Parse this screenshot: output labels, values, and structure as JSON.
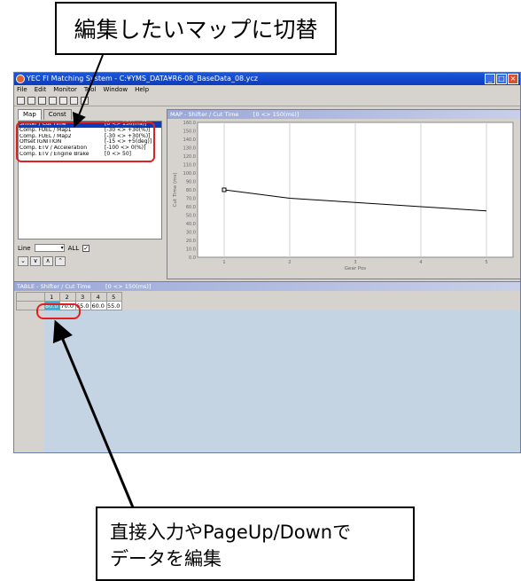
{
  "callouts": {
    "top": "編集したいマップに切替",
    "bottom_line1": "直接入力やPageUp/Downで",
    "bottom_line2": "データを編集"
  },
  "window": {
    "title": "YEC FI Matching System - C:¥YMS_DATA¥R6-08_BaseData_08.ycz",
    "menu": [
      "File",
      "Edit",
      "Monitor",
      "Tool",
      "Window",
      "Help"
    ]
  },
  "left_panel": {
    "tabs": [
      "Map",
      "Const"
    ],
    "maps": [
      {
        "name": "Shifter / Cut Time",
        "range": "[0 <> 150(ms)]",
        "selected": true
      },
      {
        "name": "Comp. FUEL / Map1",
        "range": "[-30 <> +30(%)]",
        "selected": false
      },
      {
        "name": "Comp. FUEL / Map2",
        "range": "[-30 <> +30(%)]",
        "selected": false
      },
      {
        "name": "Offset IGNITION",
        "range": "[-15 <> +5(deg)]",
        "selected": false
      },
      {
        "name": "Comp. ETV / Acceleration",
        "range": "[-100 <> 0(%)]",
        "selected": false
      },
      {
        "name": "Comp. ETV / Engine Brake",
        "range": "[0 <> 50]",
        "selected": false
      }
    ],
    "line_label": "Line",
    "all_label": "ALL",
    "all_checked": true
  },
  "map_panel": {
    "title": "MAP - Shifter / Cut Time        [0 <> 150(ms)]"
  },
  "chart_data": {
    "type": "line",
    "title": "",
    "xlabel": "Gear Pos",
    "ylabel": "Cut Time (ms)",
    "x": [
      1,
      2,
      3,
      4,
      5
    ],
    "series": [
      {
        "values": [
          80.0,
          70.0,
          65.0,
          60.0,
          55.0
        ]
      }
    ],
    "ylim": [
      0,
      160
    ],
    "yticks": [
      "160.0",
      "150.0",
      "140.0",
      "130.0",
      "120.0",
      "110.0",
      "100.0",
      "90.0",
      "80.0",
      "70.0",
      "60.0",
      "50.0",
      "40.0",
      "30.0",
      "20.0",
      "10.0",
      "0.0"
    ],
    "xticks": [
      "1",
      "2",
      "3",
      "4",
      "5"
    ],
    "grid": true
  },
  "table_panel": {
    "title": "TABLE - Shifter / Cut Time        [0 <> 150(ms)]",
    "headers": [
      "1",
      "2",
      "3",
      "4",
      "5"
    ],
    "values": [
      "80.0",
      "70.0",
      "65.0",
      "60.0",
      "55.0"
    ],
    "active_index": 0
  }
}
